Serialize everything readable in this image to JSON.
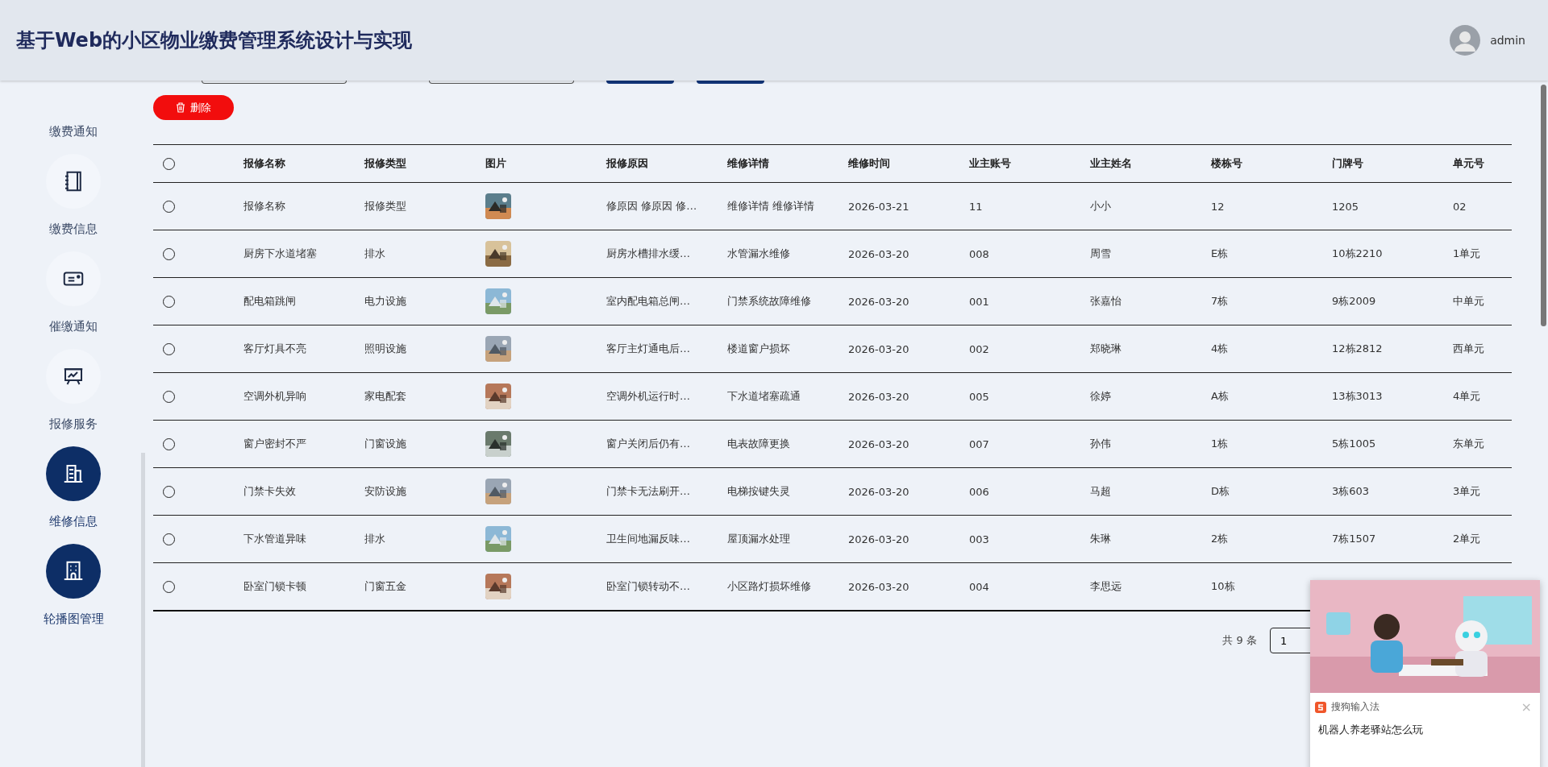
{
  "header": {
    "title": "基于Web的小区物业缴费管理系统设计与实现",
    "user": "admin"
  },
  "sidebar": {
    "items": [
      {
        "label": "缴费通知",
        "highlighted": false
      },
      {
        "label": "缴费信息",
        "highlighted": false
      },
      {
        "label": "催缴通知",
        "highlighted": false
      },
      {
        "label": "报修服务",
        "highlighted": false
      },
      {
        "label": "维修信息",
        "highlighted": true
      },
      {
        "label": "轮播图管理",
        "highlighted": true
      }
    ]
  },
  "toolbar": {
    "delete_button": "删除"
  },
  "table": {
    "select_all": {
      "checked": false
    },
    "columns": [
      "报修名称",
      "报修类型",
      "图片",
      "报修原因",
      "维修详情",
      "维修时间",
      "业主账号",
      "业主姓名",
      "楼栋号",
      "门牌号",
      "单元号"
    ],
    "rows": [
      {
        "selected": false,
        "cells": [
          "报修名称",
          "报修类型",
          null,
          "修原因 修原因 修…",
          "维修详情 维修详情",
          "2026-03-21",
          "11",
          "小小",
          "12",
          "1205",
          "02"
        ]
      },
      {
        "selected": false,
        "cells": [
          "厨房下水道堵塞",
          "排水",
          null,
          "厨房水槽排水缓…",
          "水管漏水维修",
          "2026-03-20",
          "008",
          "周雪",
          "E栋",
          "10栋2210",
          "1单元"
        ]
      },
      {
        "selected": false,
        "cells": [
          "配电箱跳闸",
          "电力设施",
          null,
          "室内配电箱总闸…",
          "门禁系统故障维修",
          "2026-03-20",
          "001",
          "张嘉怡",
          "7栋",
          "9栋2009",
          "中单元"
        ]
      },
      {
        "selected": false,
        "cells": [
          "客厅灯具不亮",
          "照明设施",
          null,
          "客厅主灯通电后…",
          "楼道窗户损坏",
          "2026-03-20",
          "002",
          "郑晓琳",
          "4栋",
          "12栋2812",
          "西单元"
        ]
      },
      {
        "selected": false,
        "cells": [
          "空调外机异响",
          "家电配套",
          null,
          "空调外机运行时…",
          "下水道堵塞疏通",
          "2026-03-20",
          "005",
          "徐婷",
          "A栋",
          "13栋3013",
          "4单元"
        ]
      },
      {
        "selected": false,
        "cells": [
          "窗户密封不严",
          "门窗设施",
          null,
          "窗户关闭后仍有…",
          "电表故障更换",
          "2026-03-20",
          "007",
          "孙伟",
          "1栋",
          "5栋1005",
          "东单元"
        ]
      },
      {
        "selected": false,
        "cells": [
          "门禁卡失效",
          "安防设施",
          null,
          "门禁卡无法刷开…",
          "电梯按键失灵",
          "2026-03-20",
          "006",
          "马超",
          "D栋",
          "3栋603",
          "3单元"
        ]
      },
      {
        "selected": false,
        "cells": [
          "下水管道异味",
          "排水",
          null,
          "卫生间地漏反味…",
          "屋顶漏水处理",
          "2026-03-20",
          "003",
          "朱琳",
          "2栋",
          "7栋1507",
          "2单元"
        ]
      },
      {
        "selected": false,
        "cells": [
          "卧室门锁卡顿",
          "门窗五金",
          null,
          "卧室门锁转动不…",
          "小区路灯损坏维修",
          "2026-03-20",
          "004",
          "李思远",
          "10栋"
        ]
      }
    ]
  },
  "pagination": {
    "total": "共 9 条",
    "page_size": "1"
  },
  "popup": {
    "brand": "搜狗输入法",
    "close": "×",
    "text": "机器人养老驿站怎么玩"
  }
}
